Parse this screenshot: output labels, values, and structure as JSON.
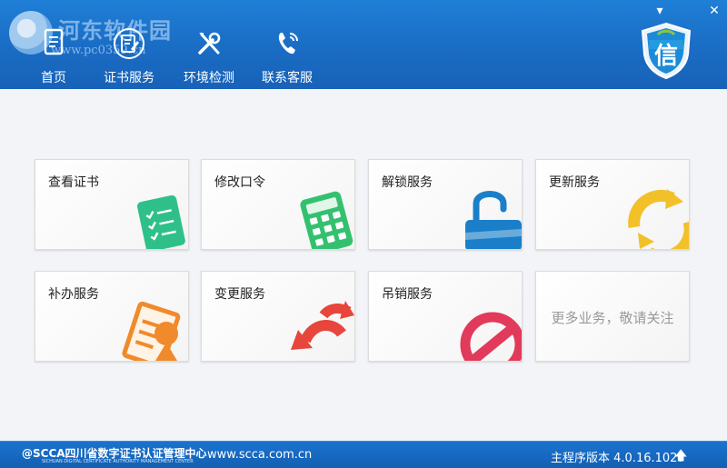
{
  "window": {
    "controls": {
      "menu": "▾",
      "close": "✕"
    }
  },
  "watermark": {
    "text": "河东软件园",
    "url": "www.pc0359.cn"
  },
  "nav": {
    "items": [
      {
        "label": "首页",
        "icon": "document-icon"
      },
      {
        "label": "证书服务",
        "icon": "certificate-edit-icon"
      },
      {
        "label": "环境检测",
        "icon": "tools-icon"
      },
      {
        "label": "联系客服",
        "icon": "phone-icon"
      }
    ]
  },
  "brand": {
    "shield_char": "信"
  },
  "tiles": [
    {
      "label": "查看证书",
      "icon": "checklist-icon",
      "color": "#2fc08a"
    },
    {
      "label": "修改口令",
      "icon": "calculator-icon",
      "color": "#34c16f"
    },
    {
      "label": "解锁服务",
      "icon": "unlock-icon",
      "color": "#1a7fc8"
    },
    {
      "label": "更新服务",
      "icon": "refresh-icon",
      "color": "#f2c12a"
    },
    {
      "label": "补办服务",
      "icon": "reissue-doc-icon",
      "color": "#f08a2a"
    },
    {
      "label": "变更服务",
      "icon": "swap-arrows-icon",
      "color": "#e8453c"
    },
    {
      "label": "吊销服务",
      "icon": "revoke-icon",
      "color": "#e23a5a"
    },
    {
      "label": "更多业务，敬请关注"
    }
  ],
  "footer": {
    "org_abbr": "@SCCA四川省数字证书认证管理中心",
    "org_en": "SICHUAN DIGITAL CERTIFICATE AUTHORITY MANAGEMENT CENTER",
    "url": "www.scca.com.cn",
    "version": "主程序版本 4.0.16.1027",
    "up_icon": "🡅"
  }
}
